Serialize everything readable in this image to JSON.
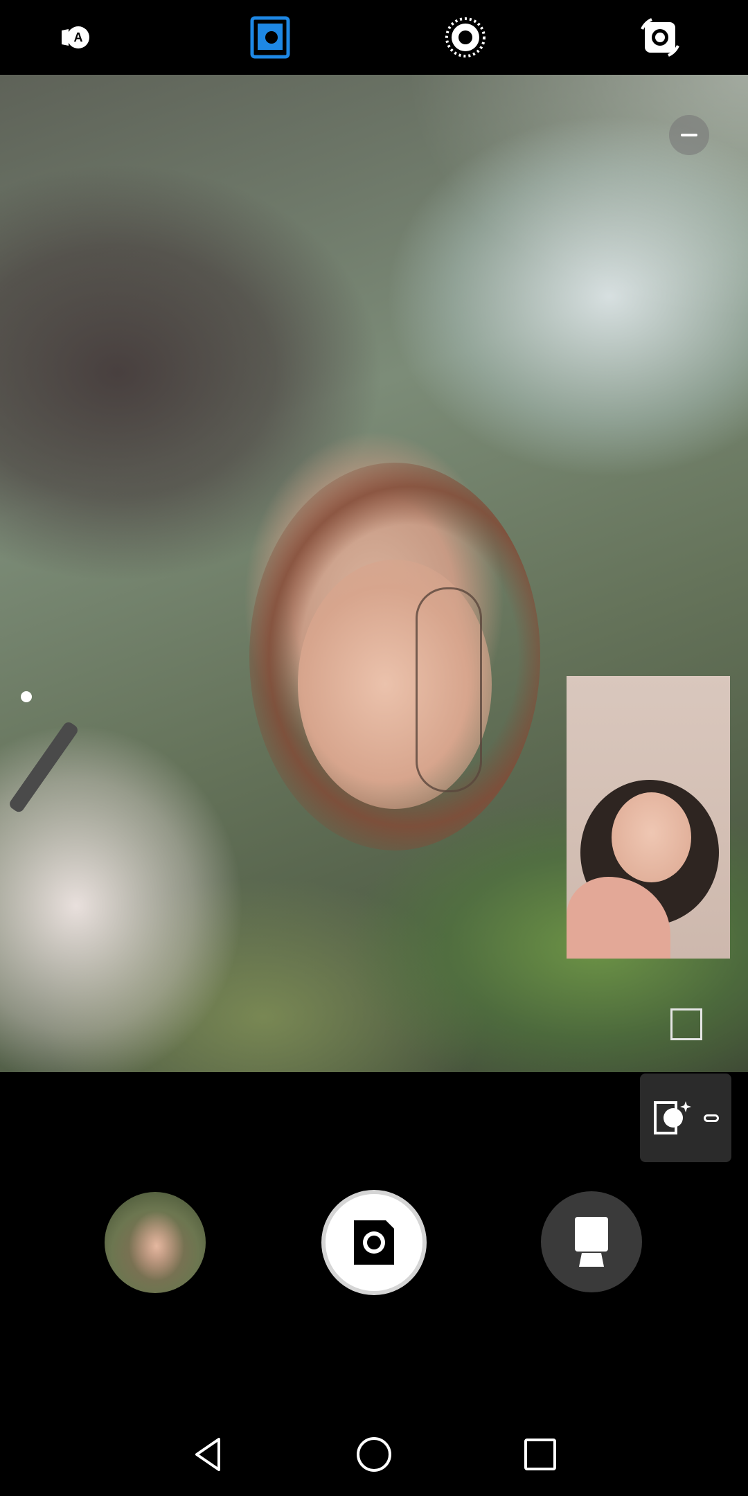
{
  "top_bar": {
    "icons": [
      "auto-mode-icon",
      "dual-view-icon",
      "live-photo-icon",
      "switch-camera-icon"
    ],
    "active_color": "#1e88e5"
  },
  "viewfinder": {
    "zoom_icon": "zoom-out-icon",
    "aspect_icon": "aspect-ratio-icon"
  },
  "controls": {
    "beauty_icon": "beauty-mode-icon",
    "gallery_icon": "gallery-thumbnail",
    "shutter_icon": "shutter-icon",
    "mode_icon": "portrait-mode-icon"
  },
  "nav_bar": {
    "icons": [
      "back-icon",
      "home-icon",
      "recents-icon"
    ]
  }
}
